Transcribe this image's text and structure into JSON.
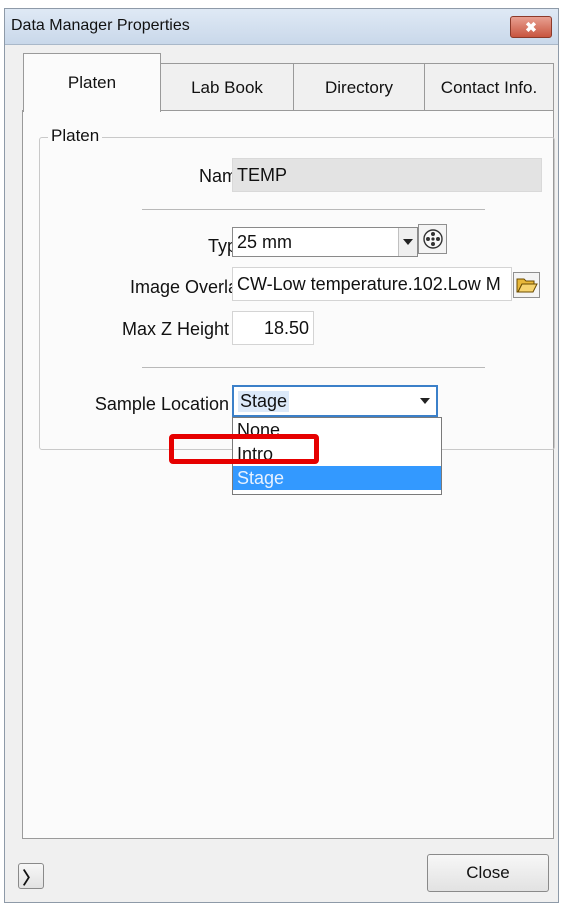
{
  "window": {
    "title": "Data Manager Properties",
    "close_glyph": "✖"
  },
  "tabs": [
    {
      "label": "Platen",
      "active": true
    },
    {
      "label": "Lab Book",
      "active": false
    },
    {
      "label": "Directory",
      "active": false
    },
    {
      "label": "Contact Info.",
      "active": false
    }
  ],
  "platen": {
    "group_label": "Platen",
    "name": {
      "label": "Name",
      "value": "TEMP"
    },
    "type": {
      "label": "Type",
      "value": "25 mm"
    },
    "image_overlay": {
      "label": "Image Overlay",
      "value": "CW-Low temperature.102.Low M"
    },
    "max_z_height": {
      "label": "Max Z Height",
      "value": "18.50"
    },
    "sample_location": {
      "label": "Sample Location",
      "value": "Stage",
      "options": [
        "None",
        "Intro",
        "Stage"
      ],
      "highlighted_option": "Stage"
    }
  },
  "footer": {
    "expand_glyph": "〉",
    "close_label": "Close"
  },
  "colors": {
    "selection": "#3399ff",
    "annotation": "#e60000",
    "titlebar": "#c9d8ea"
  }
}
